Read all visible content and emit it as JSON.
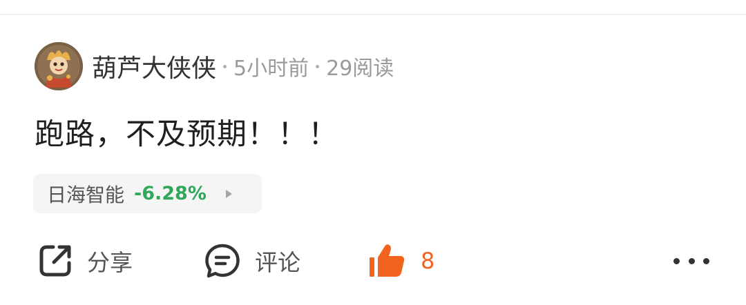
{
  "post": {
    "author": "葫芦大侠侠",
    "time": "5小时前",
    "reads": "29阅读",
    "content": "跑路，不及预期！！！",
    "stock": {
      "name": "日海智能",
      "change": "-6.28%",
      "change_color": "#2fa85a"
    }
  },
  "actions": {
    "share_label": "分享",
    "comment_label": "评论",
    "like_count": "8",
    "like_color": "#f2631f"
  },
  "icons": {
    "share": "share-icon",
    "comment": "comment-icon",
    "like": "thumbs-up-icon",
    "more": "more-icon",
    "stock_arrow": "triangle-right-icon"
  }
}
